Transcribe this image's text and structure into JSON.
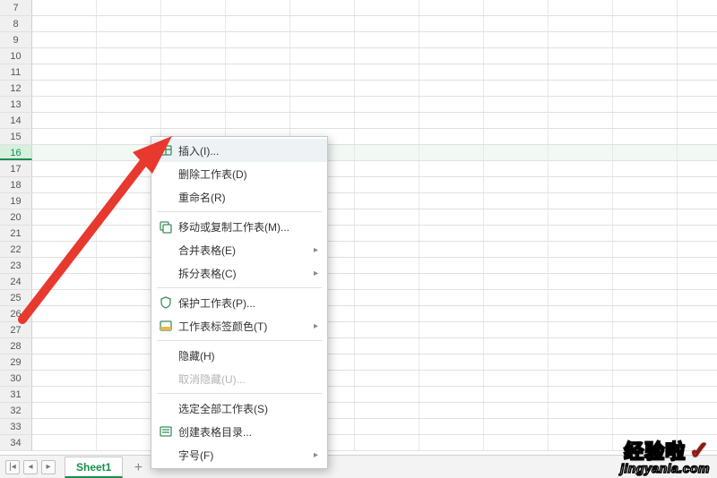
{
  "rows": {
    "start": 7,
    "end": 34,
    "selected": 16
  },
  "columns_count": 12,
  "tabs": {
    "active_label": "Sheet1",
    "nav_first": "|◂",
    "nav_prev": "◂",
    "nav_next": "▸",
    "add_label": "+"
  },
  "menu": {
    "items": [
      {
        "label": "插入(I)...",
        "icon": "table-insert-icon",
        "hover": true
      },
      {
        "label": "删除工作表(D)"
      },
      {
        "label": "重命名(R)"
      },
      {
        "sep": true
      },
      {
        "label": "移动或复制工作表(M)...",
        "icon": "table-move-icon"
      },
      {
        "label": "合并表格(E)",
        "sub": true
      },
      {
        "label": "拆分表格(C)",
        "sub": true
      },
      {
        "sep": true
      },
      {
        "label": "保护工作表(P)...",
        "icon": "shield-icon"
      },
      {
        "label": "工作表标签颜色(T)",
        "icon": "color-icon",
        "sub": true
      },
      {
        "sep": true
      },
      {
        "label": "隐藏(H)"
      },
      {
        "label": "取消隐藏(U)...",
        "disabled": true
      },
      {
        "sep": true
      },
      {
        "label": "选定全部工作表(S)"
      },
      {
        "label": "创建表格目录...",
        "icon": "list-icon"
      },
      {
        "label": "字号(F)",
        "sub": true
      }
    ]
  },
  "watermark": {
    "title": "经验啦",
    "check": "✓",
    "url": "jingyanla.com"
  }
}
